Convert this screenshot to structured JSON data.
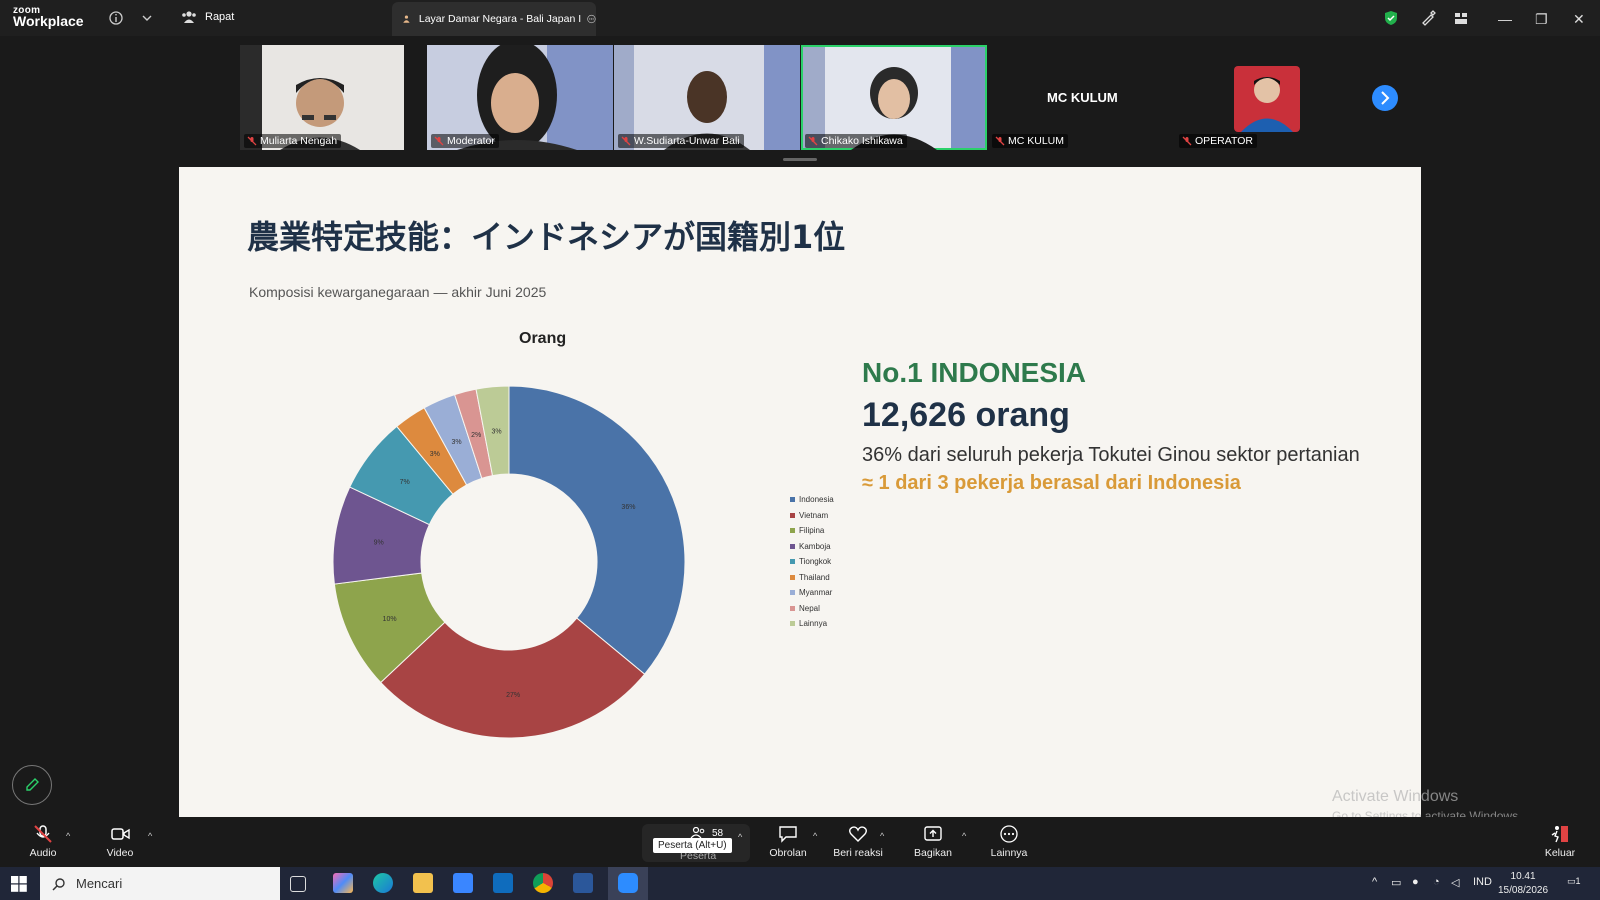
{
  "app": {
    "logo_top": "zoom",
    "logo_bottom": "Workplace",
    "meeting_tab": "Rapat",
    "share_tab": "Layar Damar Negara - Bali Japan I"
  },
  "participants": [
    {
      "name": "Muliarta Nengah"
    },
    {
      "name": "Moderator"
    },
    {
      "name": "W.Sudiarta-Unwar Bali"
    },
    {
      "name": "Chikako Ishikawa"
    },
    {
      "name": "MC KULUM",
      "banner": "MC KULUM"
    },
    {
      "name": "OPERATOR"
    }
  ],
  "slide": {
    "title": "農業特定技能：インドネシアが国籍別1位",
    "subtitle": "Komposisi kewarganegaraan — akhir Juni 2025",
    "headline": "No.1  INDONESIA",
    "count": "12,626 orang",
    "line1": "36% dari seluruh pekerja Tokutei Ginou sektor pertanian",
    "line2": "≈ 1 dari 3 pekerja berasal dari Indonesia"
  },
  "chart_data": {
    "type": "pie",
    "variant": "donut",
    "title": "Orang",
    "legend_position": "right",
    "categories": [
      "Indonesia",
      "Vietnam",
      "Filipina",
      "Kamboja",
      "Tiongkok",
      "Thailand",
      "Myanmar",
      "Nepal",
      "Lainnya"
    ],
    "values": [
      36,
      27,
      10,
      9,
      7,
      3,
      3,
      2,
      3
    ],
    "labels": [
      "36%",
      "27%",
      "10%",
      "9%",
      "7%",
      "3%",
      "3%",
      "2%",
      "3%"
    ],
    "colors": [
      "#4a73a8",
      "#a84444",
      "#8ea44c",
      "#6e5590",
      "#4599b0",
      "#dd8a3e",
      "#9aaed6",
      "#d99592",
      "#bccb96"
    ]
  },
  "watermark": {
    "line1": "Activate Windows",
    "line2": "Go to Settings to activate Windows."
  },
  "toolbar": {
    "audio": "Audio",
    "video": "Video",
    "participants_count": "58",
    "participants": "Peserta",
    "tooltip": "Peserta (Alt+U)",
    "chat": "Obrolan",
    "react": "Beri reaksi",
    "share": "Bagikan",
    "more": "Lainnya",
    "leave": "Keluar"
  },
  "taskbar": {
    "search_placeholder": "Mencari",
    "lang": "IND",
    "time": "10.41",
    "date": "15/08/2026",
    "notif_count": "1"
  }
}
